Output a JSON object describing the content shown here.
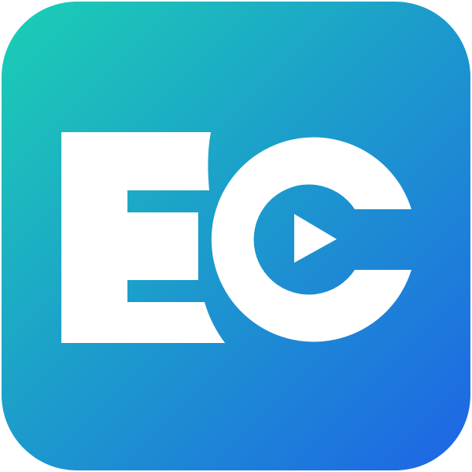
{
  "app_icon": {
    "name": "EC",
    "gradient_start": "#1BCFB4",
    "gradient_end": "#1E64E6",
    "glyph_color": "#FFFFFF",
    "play_color": "#1D9BD6"
  }
}
